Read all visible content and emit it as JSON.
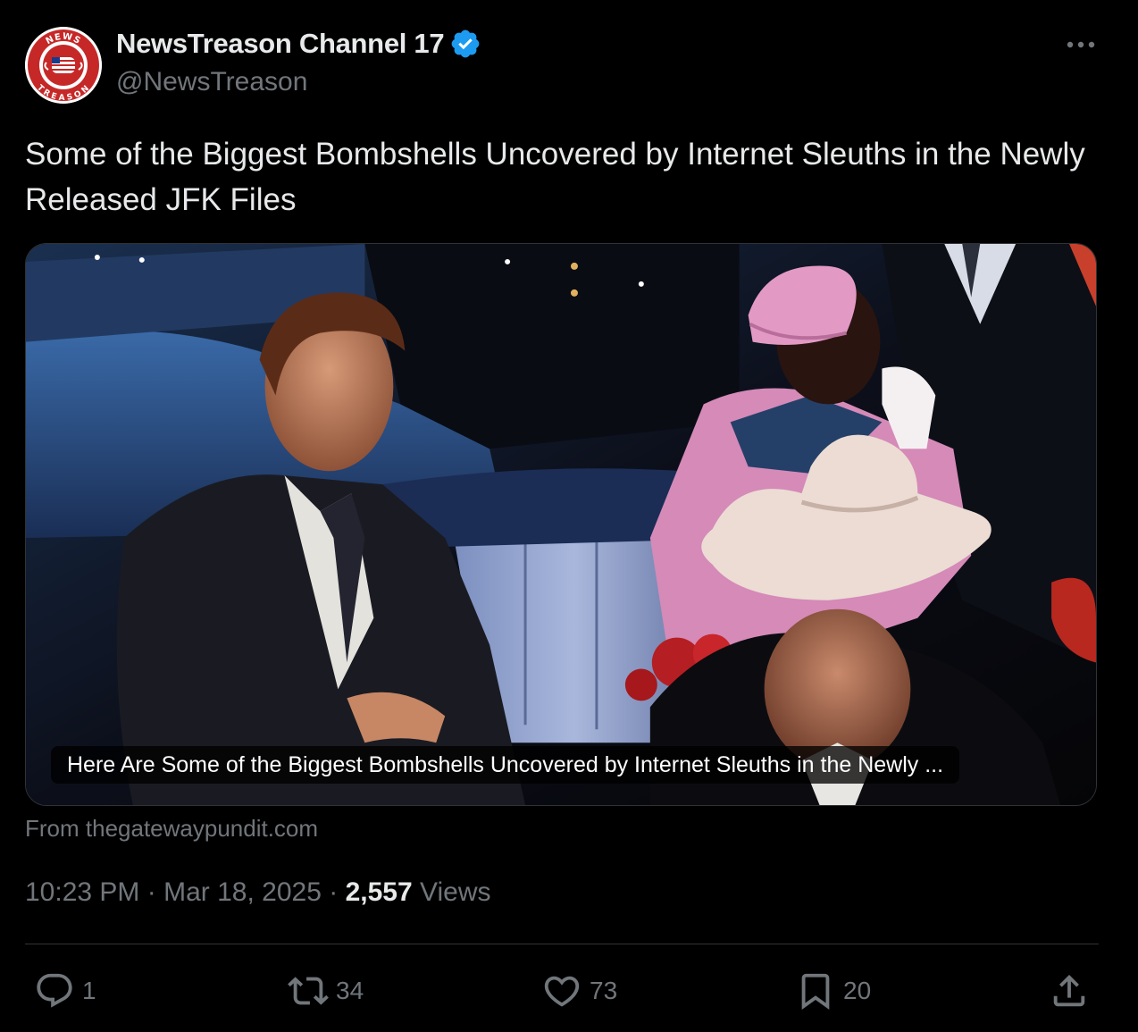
{
  "account": {
    "display_name": "NewsTreason Channel 17",
    "handle": "@NewsTreason",
    "verified": true,
    "avatar_text_top": "NEWS",
    "avatar_text_bottom": "TREASON"
  },
  "tweet": {
    "text": "Some of the Biggest Bombshells Uncovered by Internet Sleuths in the Newly Released JFK Files",
    "link_card_caption": "Here Are Some of the Biggest Bombshells Uncovered by Internet Sleuths in the Newly ...",
    "source_text": "From thegatewaypundit.com",
    "time": "10:23 PM",
    "separator": "·",
    "date": "Mar 18, 2025",
    "views_count": "2,557",
    "views_label": "Views"
  },
  "actions": {
    "reply_count": "1",
    "retweet_count": "34",
    "like_count": "73",
    "bookmark_count": "20"
  },
  "icons": {
    "more": "more-horizontal-icon",
    "reply": "reply-icon",
    "retweet": "retweet-icon",
    "like": "heart-icon",
    "bookmark": "bookmark-icon",
    "share": "share-icon",
    "verified": "verified-badge-icon"
  },
  "colors": {
    "background": "#000000",
    "text_primary": "#e7e9ea",
    "text_secondary": "#71767b",
    "verified_blue": "#1d9bf0",
    "divider": "#2f3336"
  }
}
